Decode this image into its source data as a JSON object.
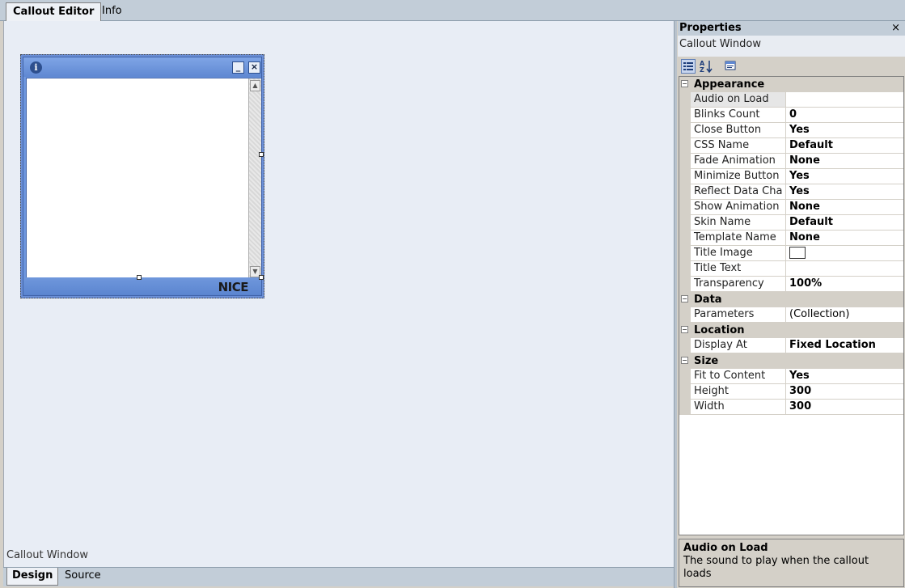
{
  "top_tabs": [
    {
      "label": "Callout Editor",
      "active": true
    },
    {
      "label": "Info",
      "active": false
    }
  ],
  "bottom_tabs": [
    {
      "label": "Design",
      "active": true
    },
    {
      "label": "Source",
      "active": false
    }
  ],
  "design": {
    "status_text": "Callout Window",
    "callout": {
      "info_glyph": "i",
      "minimize_glyph": "_",
      "close_glyph": "×",
      "logo_text": "NICE",
      "scroll_up_glyph": "▲",
      "scroll_down_glyph": "▼"
    }
  },
  "properties": {
    "title": "Properties",
    "close_glyph": "×",
    "object_name": "Callout Window",
    "toolbar": {
      "categorized_icon": "categorized-icon",
      "alphabetical_icon": "alphabetical-icon",
      "property_pages_icon": "property-pages-icon"
    },
    "categories": [
      {
        "label": "Appearance",
        "toggle": "⊟",
        "rows": [
          {
            "name": "Audio on Load",
            "value": "",
            "selected": true
          },
          {
            "name": "Blinks Count",
            "value": "0"
          },
          {
            "name": "Close Button",
            "value": "Yes"
          },
          {
            "name": "CSS Name",
            "value": "Default"
          },
          {
            "name": "Fade Animation",
            "value": "None"
          },
          {
            "name": "Minimize Button",
            "value": "Yes"
          },
          {
            "name": "Reflect Data Cha",
            "value": "Yes"
          },
          {
            "name": "Show Animation",
            "value": "None"
          },
          {
            "name": "Skin Name",
            "value": "Default"
          },
          {
            "name": "Template Name",
            "value": "None"
          },
          {
            "name": "Title Image",
            "value": "",
            "swatch": true
          },
          {
            "name": "Title Text",
            "value": ""
          },
          {
            "name": "Transparency",
            "value": "100%"
          }
        ]
      },
      {
        "label": "Data",
        "toggle": "⊟",
        "rows": [
          {
            "name": "Parameters",
            "value": "(Collection)",
            "normal": true
          }
        ]
      },
      {
        "label": "Location",
        "toggle": "⊟",
        "rows": [
          {
            "name": "Display At",
            "value": "Fixed Location"
          }
        ]
      },
      {
        "label": "Size",
        "toggle": "⊟",
        "rows": [
          {
            "name": "Fit to Content",
            "value": "Yes"
          },
          {
            "name": "Height",
            "value": "300"
          },
          {
            "name": "Width",
            "value": "300"
          }
        ]
      }
    ],
    "description": {
      "title": "Audio on Load",
      "text": "The sound to play when the callout loads"
    }
  }
}
